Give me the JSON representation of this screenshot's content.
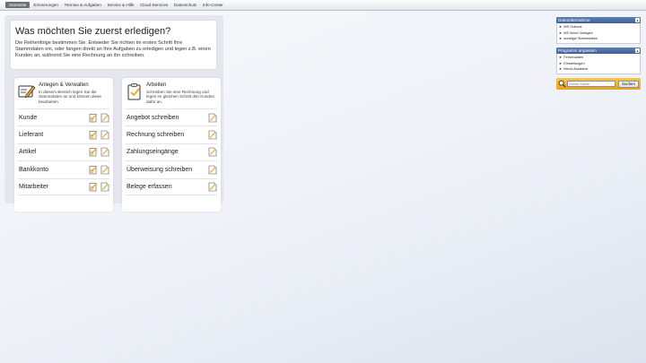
{
  "topnav": {
    "items": [
      "Startseite",
      "Erinnerungen",
      "Termine & Aufgaben",
      "Service & Hilfe",
      "Cloud-Services",
      "Datenschutz",
      "Info-Center"
    ]
  },
  "intro": {
    "title": "Was möchten Sie zuerst erledigen?",
    "text": "Die Reihenfolge bestimmen Sie. Entweder Sie richten im ersten Schritt Ihre Stammdaten ein, oder fangen direkt an Ihre Aufgaben zu erledigen und legen z.B. einen Kunden an, während Sie eine Rechnung an ihn schreiben."
  },
  "left_col": {
    "title": "Anlegen & Verwalten",
    "desc": "In diesem Bereich legen Sie die Stammdaten an und können diese bearbeiten.",
    "rows": [
      "Kunde",
      "Lieferant",
      "Artikel",
      "Bankkonto",
      "Mitarbeiter"
    ]
  },
  "right_col": {
    "title": "Arbeiten",
    "desc": "Schreiben Sie eine Rechnung und legen im gleichen Schritt den Kunden dafür an.",
    "rows": [
      "Angebot schreiben",
      "Rechnung schreiben",
      "Zahlungseingänge",
      "Überweisung schreiben",
      "Belege erfassen"
    ]
  },
  "sidebar": {
    "import": {
      "title": "Datenübernahme",
      "links": [
        "MS Outlook",
        "MS Word Vorlagen",
        "sonstige Stammdaten"
      ]
    },
    "program": {
      "title": "Programm anpassen",
      "links": [
        "Firmendaten",
        "Einstellungen",
        "Menü-Assistent"
      ]
    }
  },
  "search": {
    "placeholder": "Online-Suche",
    "button": "Suchen"
  },
  "colors": {
    "accent_orange": "#e8a21a",
    "sidebar_blue": "#3f6096"
  }
}
